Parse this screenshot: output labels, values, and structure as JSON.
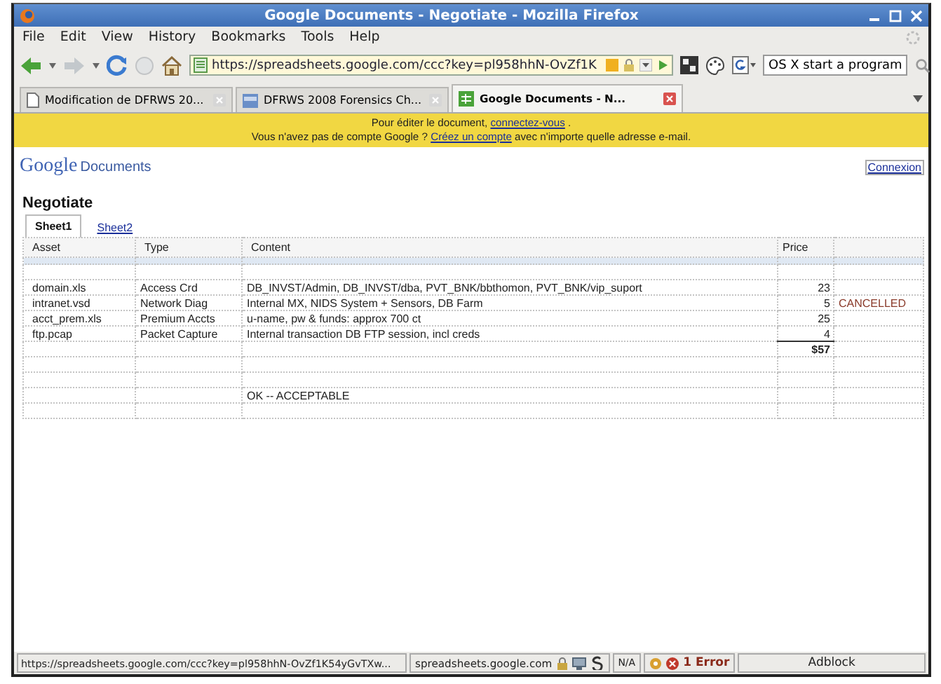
{
  "window": {
    "title": "Google Documents - Negotiate - Mozilla Firefox"
  },
  "menu": [
    "File",
    "Edit",
    "View",
    "History",
    "Bookmarks",
    "Tools",
    "Help"
  ],
  "address": {
    "value": "https://spreadsheets.google.com/ccc?key=pl958hhN-OvZf1K"
  },
  "search": {
    "value": "OS X start a program"
  },
  "tabs": [
    {
      "label": "Modification de DFRWS 20...",
      "selected": false
    },
    {
      "label": "DFRWS 2008 Forensics Ch...",
      "selected": false
    },
    {
      "label": "Google Documents - N...",
      "selected": true
    }
  ],
  "banner": {
    "line_1": {
      "before": "Pour éditer le document, ",
      "link": "connectez-vous",
      "after": " ."
    },
    "line_2": {
      "before": "Vous n'avez pas de compte Google ? ",
      "link": "Créez un compte",
      "after": " avec n'importe quelle adresse e-mail."
    }
  },
  "logo": {
    "brand": "Google",
    "product": "Documents"
  },
  "signin_link": "Connexion",
  "document": {
    "title": "Negotiate"
  },
  "sheets": [
    {
      "label": "Sheet1",
      "selected": true
    },
    {
      "label": "Sheet2",
      "selected": false
    }
  ],
  "table": {
    "columns": [
      "Asset",
      "Type",
      "Content",
      "Price"
    ],
    "rows": [
      {
        "asset": "domain.xls",
        "type": "Access Crd",
        "content": "DB_INVST/Admin, DB_INVST/dba, PVT_BNK/bbthomon, PVT_BNK/vip_suport",
        "price": "23"
      },
      {
        "asset": "intranet.vsd",
        "type": "Network Diag",
        "content": "Internal MX, NIDS System + Sensors, DB Farm",
        "price": "5",
        "column_5": "CANCELLED"
      },
      {
        "asset": "acct_prem.xls",
        "type": "Premium Accts",
        "content": "u-name, pw & funds: approx 700 ct",
        "price": "25"
      },
      {
        "asset": "ftp.pcap",
        "type": "Packet Capture",
        "content": "Internal transaction DB FTP session, incl creds",
        "price": "4"
      },
      {
        "kind": "total",
        "price": "$57"
      },
      {},
      {},
      {
        "content": "OK -- ACCEPTABLE"
      },
      {}
    ]
  },
  "status_bar": {
    "url": "https://spreadsheets.google.com/ccc?key=pl958hhN-OvZf1K54yGvTXw...",
    "host": "spreadsheets.google.com",
    "na": "N/A",
    "errors": "1 Error",
    "adblock": "Adblock"
  }
}
